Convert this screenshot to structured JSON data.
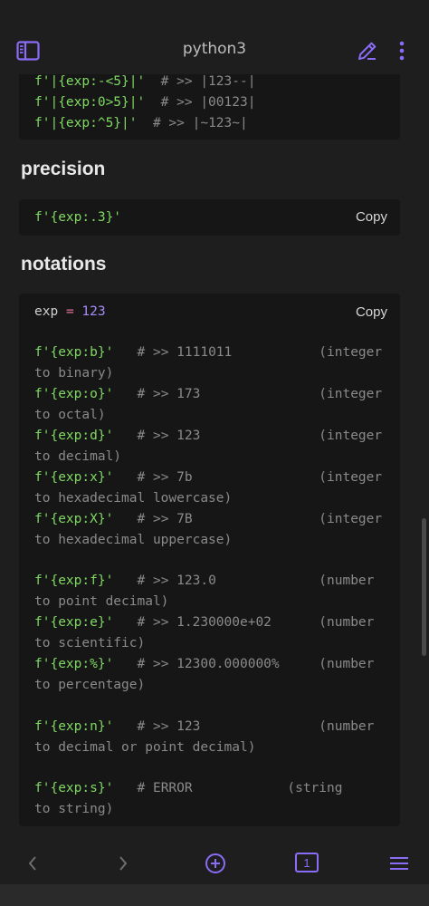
{
  "app": {
    "title": "python3"
  },
  "icons": {
    "sidebar": "sidebar-panel-icon",
    "edit": "pencil-icon",
    "more": "vertical-dots-icon",
    "back": "chevron-left-icon",
    "forward": "chevron-right-icon",
    "new_tab": "plus-circle-icon",
    "menu": "hamburger-menu-icon"
  },
  "colors": {
    "accent": "#8b6cf6",
    "string": "#7fd962",
    "comment": "#8a8a8a",
    "operator": "#e26d9d",
    "number": "#a78bfa"
  },
  "blocks": {
    "alignment": {
      "lines": [
        {
          "code": "f'|{exp:-<5}|'",
          "comment": "  # >> |123--|"
        },
        {
          "code": "f'|{exp:0>5}|'",
          "comment": "  # >> |00123|"
        },
        {
          "code": "f'|{exp:^5}|'",
          "comment": "  # >> |~123~|"
        }
      ]
    },
    "precision": {
      "heading": "precision",
      "code": "f'{exp:.3}'",
      "copy_label": "Copy"
    },
    "notations": {
      "heading": "notations",
      "copy_label": "Copy",
      "assign": {
        "var": "exp",
        "op": "=",
        "value": "123"
      },
      "lines": [
        {
          "code": "f'{exp:b}'",
          "comment": "   # >> 1111011           (integer",
          "cont": "to binary)"
        },
        {
          "code": "f'{exp:o}'",
          "comment": "   # >> 173               (integer",
          "cont": "to octal)"
        },
        {
          "code": "f'{exp:d}'",
          "comment": "   # >> 123               (integer",
          "cont": "to decimal)"
        },
        {
          "code": "f'{exp:x}'",
          "comment": "   # >> 7b                (integer",
          "cont": "to hexadecimal lowercase)"
        },
        {
          "code": "f'{exp:X}'",
          "comment": "   # >> 7B                (integer",
          "cont": "to hexadecimal uppercase)"
        },
        {
          "code": "f'{exp:f}'",
          "comment": "   # >> 123.0             (number",
          "cont": "to point decimal)"
        },
        {
          "code": "f'{exp:e}'",
          "comment": "   # >> 1.230000e+02      (number",
          "cont": "to scientific)"
        },
        {
          "code": "f'{exp:%}'",
          "comment": "   # >> 12300.000000%     (number",
          "cont": "to percentage)"
        },
        {
          "code": "f'{exp:n}'",
          "comment": "   # >> 123               (number",
          "cont": "to decimal or point decimal)"
        },
        {
          "code": "f'{exp:s}'",
          "comment": "   # ERROR            (string",
          "cont": "to string)"
        }
      ]
    }
  },
  "bottom": {
    "tab_count": "1"
  }
}
